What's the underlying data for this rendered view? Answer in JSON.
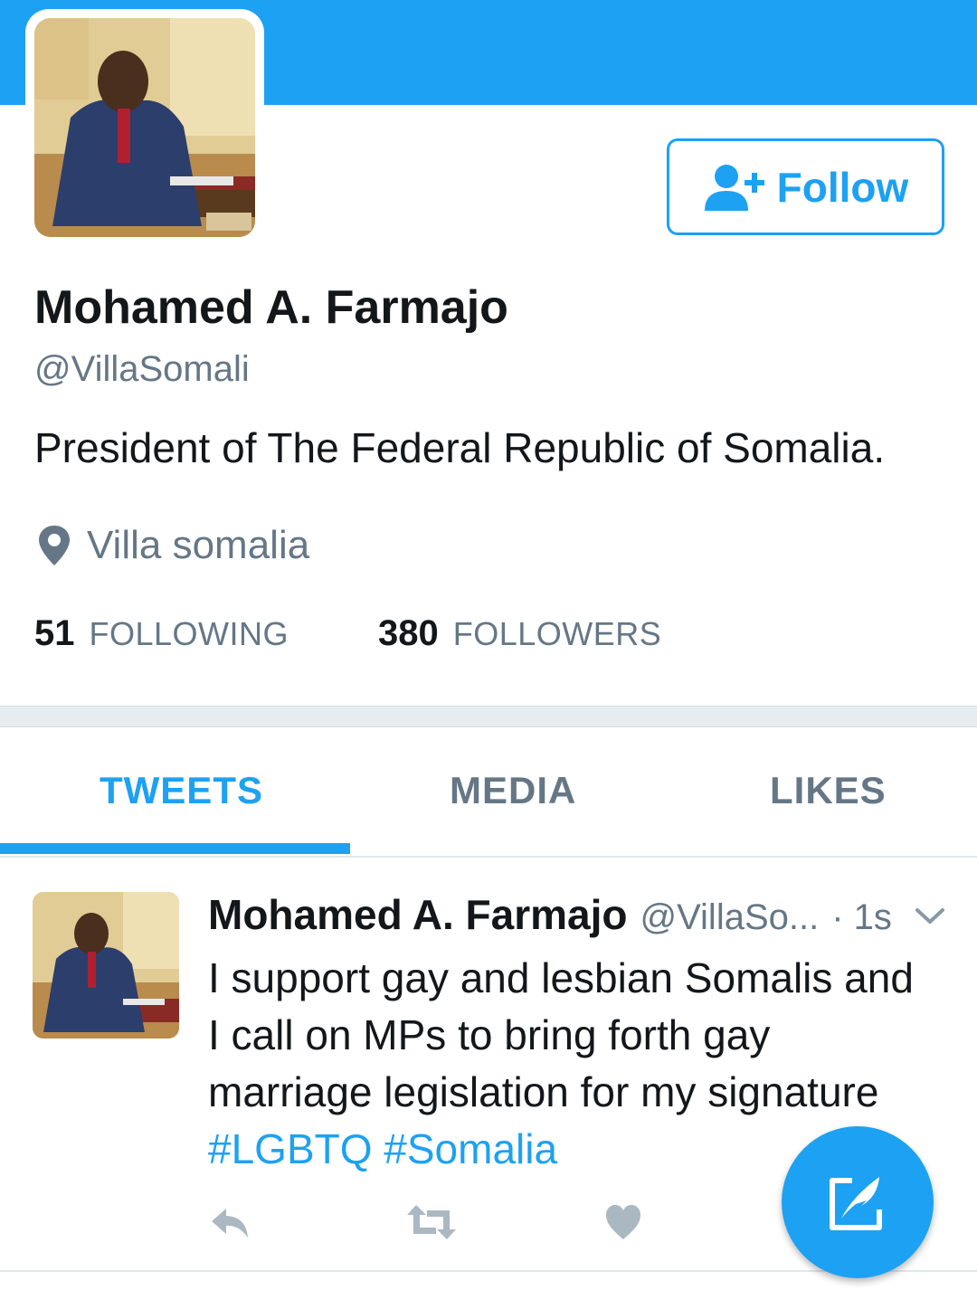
{
  "colors": {
    "accent": "#1da1f2",
    "text": "#14171a",
    "muted": "#657786"
  },
  "profile": {
    "name": "Mohamed A. Farmajo",
    "handle": "@VillaSomali",
    "bio": "President of The Federal Republic of Somalia.",
    "location": "Villa somalia",
    "following_count": "51",
    "following_label": "FOLLOWING",
    "followers_count": "380",
    "followers_label": "FOLLOWERS",
    "follow_label": "Follow",
    "avatar_icon": "profile-photo"
  },
  "tabs": [
    {
      "label": "TWEETS",
      "active": true
    },
    {
      "label": "MEDIA",
      "active": false
    },
    {
      "label": "LIKES",
      "active": false
    }
  ],
  "tweet": {
    "name": "Mohamed A. Farmajo",
    "handle": "@VillaSo...",
    "time": "· 1s",
    "text_line1": "I support gay and lesbian Somalis and",
    "text_line2": "I call on MPs to bring forth gay",
    "text_line3": "marriage legislation for my signature",
    "hashtag1": "#LGBTQ",
    "hashtag2": "#Somalia",
    "actions": [
      "reply-icon",
      "retweet-icon",
      "heart-icon"
    ]
  },
  "fab": {
    "icon": "compose-tweet-icon"
  }
}
